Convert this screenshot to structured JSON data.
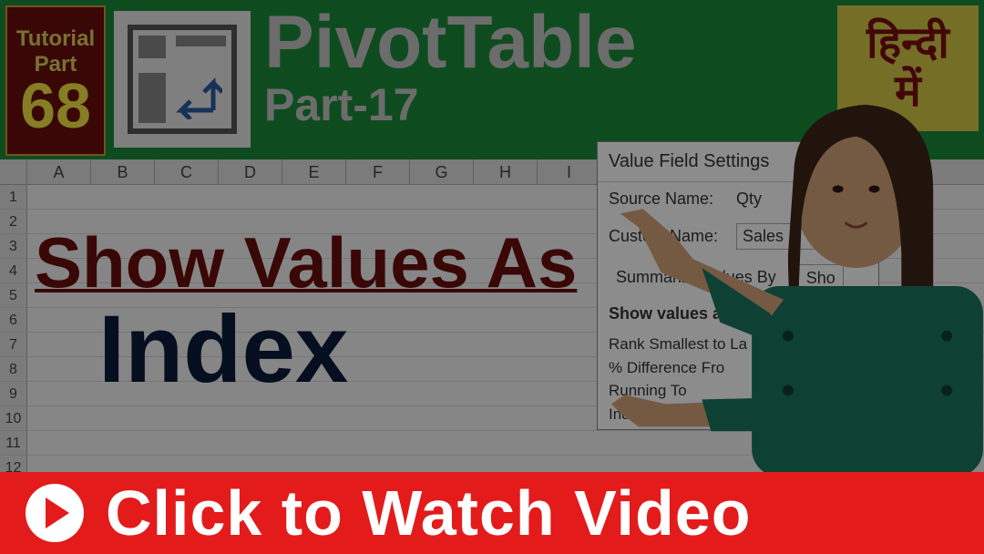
{
  "tutorialBadge": {
    "line1": "Tutorial",
    "line2": "Part",
    "number": "68"
  },
  "headerTitle": {
    "line1": "PivotTable",
    "line2": "Part-17"
  },
  "hindiBadge": {
    "line1": "हिन्दी",
    "line2": "में"
  },
  "columns": [
    "A",
    "B",
    "C",
    "D",
    "E",
    "F",
    "G",
    "H",
    "I"
  ],
  "rows": [
    "1",
    "2",
    "3",
    "4",
    "5",
    "6",
    "7",
    "8",
    "9",
    "10",
    "11",
    "12"
  ],
  "mainHeading": {
    "line1": "Show Values As",
    "line2": "Index"
  },
  "dialog": {
    "title": "Value Field Settings",
    "sourceLabel": "Source Name:",
    "sourceValue": "Qty",
    "customLabel": "Custom Name:",
    "customValue": "Sales",
    "tab1": "Summarize Values By",
    "tab2": "Sho",
    "subHeading": "Show values as",
    "listItem1": "Rank Smallest to La",
    "listItem2": "% Difference Fro",
    "listItem3": "Running To",
    "listItem4": "Index"
  },
  "bottomBar": {
    "text": "Click to Watch Video"
  }
}
